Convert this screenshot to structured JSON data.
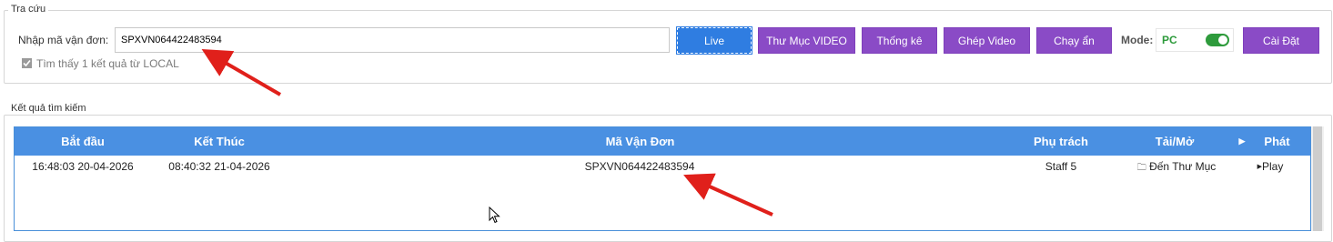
{
  "search": {
    "legend": "Tra cứu",
    "label": "Nhập mã vận đơn:",
    "value": "SPXVN064422483594",
    "result_note": "Tìm thấy 1 kết quả từ LOCAL",
    "mode_label": "Mode:",
    "mode_value": "PC",
    "buttons": {
      "live": "Live",
      "video_folder": "Thư Mục VIDEO",
      "stats": "Thống kê",
      "merge_video": "Ghép Video",
      "hidden_run": "Chạy ẩn",
      "settings": "Cài Đặt"
    }
  },
  "results": {
    "legend": "Kết quả tìm kiếm",
    "columns": [
      "Bắt đầu",
      "Kết Thúc",
      "Mã Vận Đơn",
      "Phụ trách",
      "Tải/Mở",
      "Phát"
    ],
    "rows": [
      {
        "start": "16:48:03 20-04-2026",
        "end": "08:40:32 21-04-2026",
        "code": "SPXVN064422483594",
        "staff": "Staff 5",
        "open": "Đến Thư Mục",
        "play": "Play"
      }
    ]
  },
  "colors": {
    "accent_purple": "#8a4bc6",
    "live_blue": "#2f7de1",
    "header_blue": "#4a90e2",
    "toggle_green": "#2e9b3c",
    "annotation_red": "#e0201b"
  }
}
